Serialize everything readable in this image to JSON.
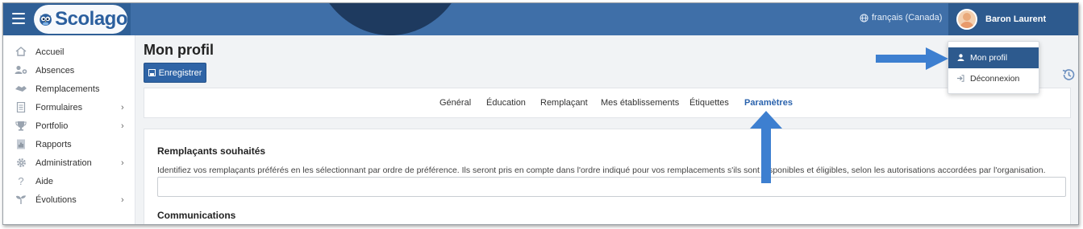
{
  "app": {
    "logo_text": "Scolago",
    "language": "français (Canada)",
    "user_name": "Baron Laurent",
    "brand_color": "#3f6fa8",
    "accent_color": "#2d5a8e"
  },
  "sidebar": {
    "items": [
      {
        "label": "Accueil",
        "icon": "home-icon",
        "has_submenu": false
      },
      {
        "label": "Absences",
        "icon": "user-absence-icon",
        "has_submenu": false
      },
      {
        "label": "Remplacements",
        "icon": "handshake-icon",
        "has_submenu": false
      },
      {
        "label": "Formulaires",
        "icon": "form-icon",
        "has_submenu": true
      },
      {
        "label": "Portfolio",
        "icon": "trophy-icon",
        "has_submenu": true
      },
      {
        "label": "Rapports",
        "icon": "report-icon",
        "has_submenu": false
      },
      {
        "label": "Administration",
        "icon": "gear-icon",
        "has_submenu": true
      },
      {
        "label": "Aide",
        "icon": "question-icon",
        "has_submenu": false
      },
      {
        "label": "Évolutions",
        "icon": "sprout-icon",
        "has_submenu": true
      }
    ],
    "chevron": "›"
  },
  "page": {
    "title": "Mon profil",
    "save_label": "Enregistrer"
  },
  "tabs": [
    {
      "label": "Général",
      "active": false
    },
    {
      "label": "Éducation",
      "active": false
    },
    {
      "label": "Remplaçant",
      "active": false
    },
    {
      "label": "Mes établissements",
      "active": false
    },
    {
      "label": "Étiquettes",
      "active": false
    },
    {
      "label": "Paramètres",
      "active": true
    }
  ],
  "content": {
    "preferred_title": "Remplaçants souhaités",
    "preferred_desc": "Identifiez vos remplaçants préférés en les sélectionnant par ordre de préférence. Ils seront pris en compte dans l'ordre indiqué pour vos remplacements s'ils sont disponibles et éligibles, selon les autorisations accordées par l'organisation.",
    "preferred_value": "",
    "communications_title": "Communications"
  },
  "user_menu": {
    "items": [
      {
        "label": "Mon profil",
        "icon": "user-icon",
        "active": true
      },
      {
        "label": "Déconnexion",
        "icon": "logout-icon",
        "active": false
      }
    ]
  }
}
